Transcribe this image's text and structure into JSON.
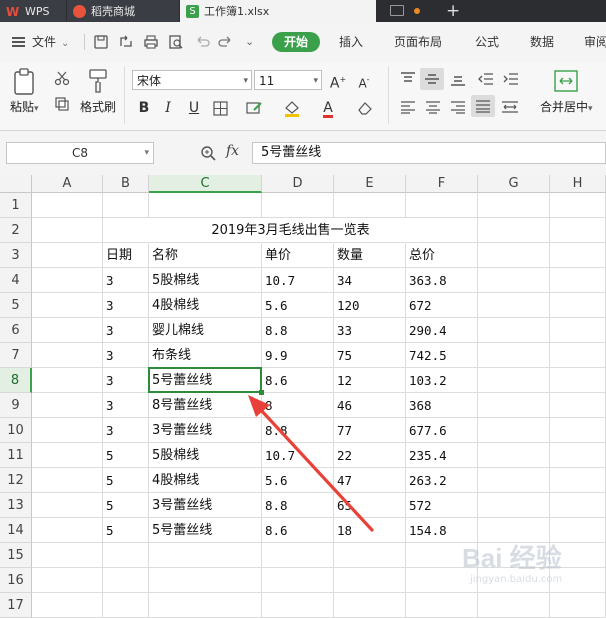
{
  "titlebar": {
    "tabs": [
      {
        "label": "WPS"
      },
      {
        "label": "稻壳商城"
      },
      {
        "label": "工作簿1.xlsx"
      }
    ],
    "new_tab_label": "+"
  },
  "menubar": {
    "file_label": "文件",
    "start_label": "开始",
    "items": [
      "插入",
      "页面布局",
      "公式",
      "数据",
      "审阅"
    ]
  },
  "ribbon": {
    "paste_label": "粘贴",
    "format_painter_label": "格式刷",
    "font_name": "宋体",
    "font_size": "11",
    "font_grow": "A",
    "font_shrink": "A",
    "bold": "B",
    "italic": "I",
    "underline": "U",
    "font_color_letter": "A",
    "merge_label": "合并居中"
  },
  "formula": {
    "name_box": "C8",
    "fx_label": "fx",
    "content": "5号蕾丝线"
  },
  "columns": [
    "A",
    "B",
    "C",
    "D",
    "E",
    "F",
    "G",
    "H"
  ],
  "active_cell": {
    "column": "C",
    "row": 8
  },
  "sheet": {
    "title": "2019年3月毛线出售一览表",
    "headers": [
      "日期",
      "名称",
      "单价",
      "数量",
      "总价"
    ],
    "rows": [
      [
        "3",
        "5股棉线",
        "10.7",
        "34",
        "363.8"
      ],
      [
        "3",
        "4股棉线",
        "5.6",
        "120",
        "672"
      ],
      [
        "3",
        "婴儿棉线",
        "8.8",
        "33",
        "290.4"
      ],
      [
        "3",
        "布条线",
        "9.9",
        "75",
        "742.5"
      ],
      [
        "3",
        "5号蕾丝线",
        "8.6",
        "12",
        "103.2"
      ],
      [
        "3",
        "8号蕾丝线",
        "8",
        "46",
        "368"
      ],
      [
        "3",
        "3号蕾丝线",
        "8.8",
        "77",
        "677.6"
      ],
      [
        "5",
        "5股棉线",
        "10.7",
        "22",
        "235.4"
      ],
      [
        "5",
        "4股棉线",
        "5.6",
        "47",
        "263.2"
      ],
      [
        "5",
        "3号蕾丝线",
        "8.8",
        "65",
        "572"
      ],
      [
        "5",
        "5号蕾丝线",
        "8.6",
        "18",
        "154.8"
      ]
    ],
    "row_numbers": [
      "1",
      "2",
      "3",
      "4",
      "5",
      "6",
      "7",
      "8",
      "9",
      "10",
      "11",
      "12",
      "13",
      "14",
      "15",
      "16",
      "17"
    ]
  },
  "colors": {
    "accent": "#3aa14a",
    "arrow": "#e8413a"
  },
  "watermark": {
    "text": "Bai 经验",
    "url": "jingyan.baidu.com"
  }
}
